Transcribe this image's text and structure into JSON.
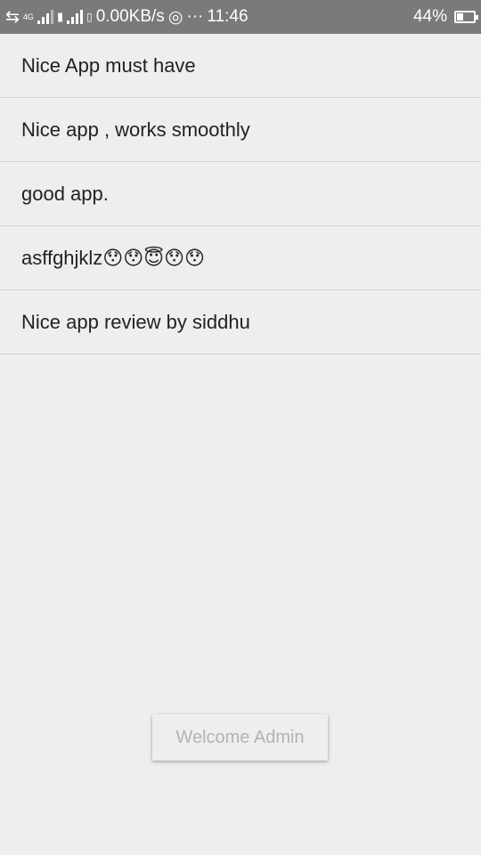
{
  "status_bar": {
    "network_type": "4G",
    "data_speed": "0.00KB/s",
    "dots": "···",
    "time": "11:46",
    "battery_percent_text": "44%",
    "battery_level": 0.44
  },
  "reviews": [
    {
      "text": "Nice App must have"
    },
    {
      "text": "Nice app , works smoothly"
    },
    {
      "text": "good app."
    },
    {
      "text": "asffghjklz😯😯😇😯😯"
    },
    {
      "text": "Nice app review by siddhu"
    }
  ],
  "toast": {
    "message": "Welcome Admin"
  }
}
